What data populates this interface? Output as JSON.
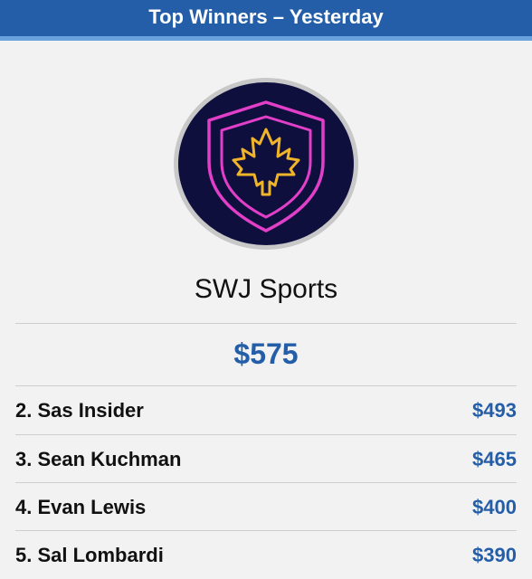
{
  "header": {
    "title": "Top Winners – Yesterday"
  },
  "winner": {
    "logo_icon": "shield-maple-leaf-icon",
    "name": "SWJ Sports",
    "amount": "$575"
  },
  "rankings": [
    {
      "label": "2. Sas Insider",
      "amount": "$493"
    },
    {
      "label": "3. Sean Kuchman",
      "amount": "$465"
    },
    {
      "label": "4. Evan Lewis",
      "amount": "$400"
    },
    {
      "label": "5. Sal Lombardi",
      "amount": "$390"
    }
  ],
  "colors": {
    "header_bg": "#245ea8",
    "accent": "#245ea8",
    "logo_bg": "#0e0f3d",
    "logo_shield": "#e23fc9",
    "logo_leaf": "#f0b429"
  }
}
